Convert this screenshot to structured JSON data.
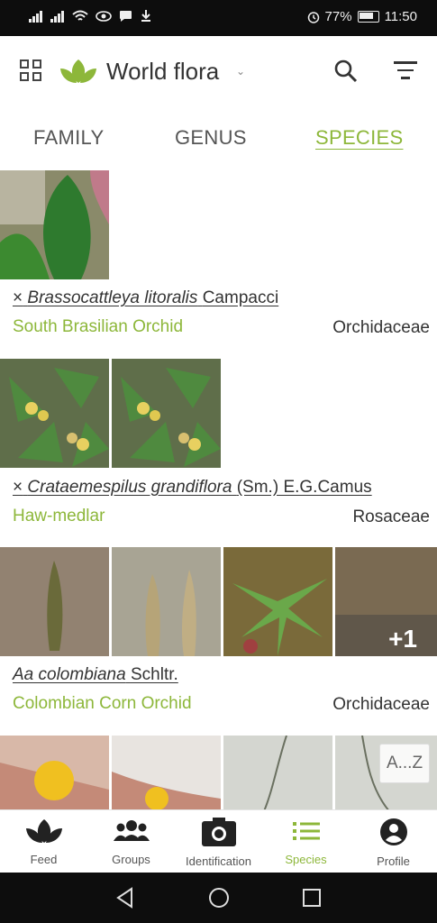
{
  "status": {
    "battery_percent": "77%",
    "time": "11:50"
  },
  "header": {
    "title": "World flora"
  },
  "tabs": [
    {
      "label": "FAMILY",
      "active": false
    },
    {
      "label": "GENUS",
      "active": false
    },
    {
      "label": "SPECIES",
      "active": true
    }
  ],
  "species": [
    {
      "sci_prefix": "×",
      "sci_italic": "Brassocattleya litoralis",
      "author": "Campacci",
      "common": "South Brasilian Orchid",
      "family": "Orchidaceae"
    },
    {
      "sci_prefix": "×",
      "sci_italic": "Crataemespilus grandiflora",
      "author": "(Sm.) E.G.Camus",
      "common": "Haw-medlar",
      "family": "Rosaceae"
    },
    {
      "sci_prefix": "",
      "sci_italic": "Aa colombiana",
      "author": "Schltr.",
      "common": "Colombian Corn Orchid",
      "family": "Orchidaceae",
      "more_photos": "+1"
    }
  ],
  "az_button": "A...Z",
  "bottom_nav": [
    {
      "label": "Feed",
      "icon": "leaf-icon"
    },
    {
      "label": "Groups",
      "icon": "people-icon"
    },
    {
      "label": "Identification",
      "icon": "camera-icon"
    },
    {
      "label": "Species",
      "icon": "list-icon",
      "active": true
    },
    {
      "label": "Profile",
      "icon": "account-icon"
    }
  ],
  "colors": {
    "accent": "#8db73a",
    "text": "#333333"
  }
}
